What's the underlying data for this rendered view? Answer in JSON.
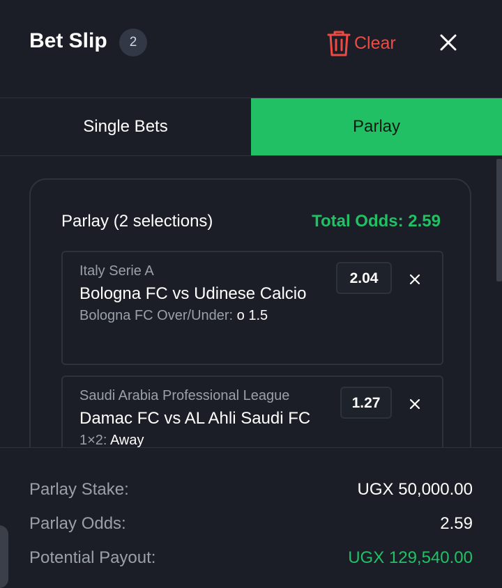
{
  "header": {
    "title": "Bet Slip",
    "count": "2",
    "clear_label": "Clear"
  },
  "tabs": [
    {
      "label": "Single Bets",
      "active": false
    },
    {
      "label": "Parlay",
      "active": true
    }
  ],
  "parlay": {
    "heading": "Parlay (2 selections)",
    "total_odds": "Total Odds: 2.59",
    "selections": [
      {
        "league": "Italy Serie A",
        "match": "Bologna FC vs Udinese Calcio",
        "market": "Bologna FC Over/Under:",
        "pick": "o 1.5",
        "odds": "2.04"
      },
      {
        "league": "Saudi Arabia Professional League",
        "match": "Damac FC vs AL Ahli Saudi FC",
        "market": "1×2:",
        "pick": "Away",
        "odds": "1.27"
      }
    ]
  },
  "summary": {
    "stake_label": "Parlay Stake:",
    "stake_value": "UGX 50,000.00",
    "odds_label": "Parlay Odds:",
    "odds_value": "2.59",
    "payout_label": "Potential Payout:",
    "payout_value": "UGX 129,540.00"
  },
  "colors": {
    "background": "#1b1e26",
    "accent_green": "#22c065",
    "clear_red": "#ef4b43",
    "border": "#2e323c",
    "muted_text": "#9aa0ab"
  },
  "icons": {
    "clear": "trash-icon",
    "close": "close-icon",
    "remove": "close-icon"
  }
}
